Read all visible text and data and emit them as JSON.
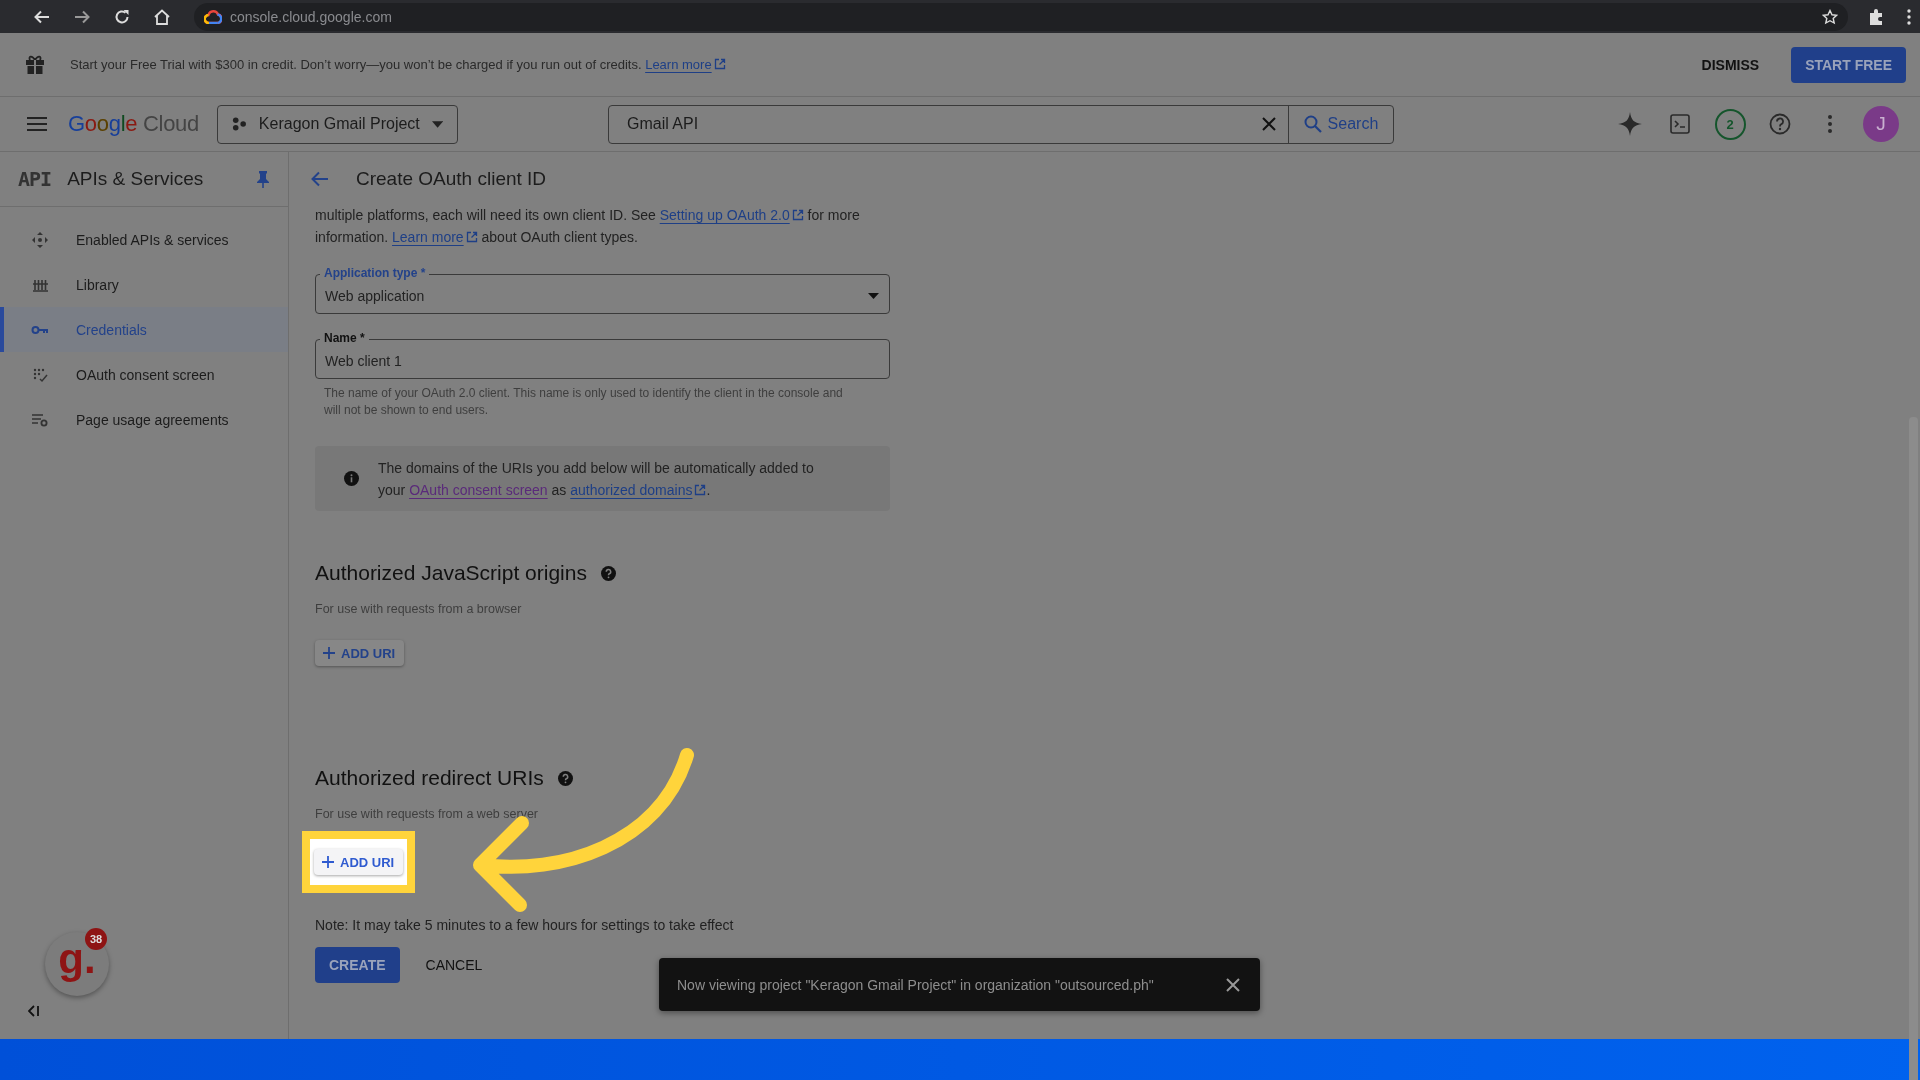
{
  "browser": {
    "url": "console.cloud.google.com"
  },
  "banner": {
    "text": "Start your Free Trial with $300 in credit. Don’t worry—you won’t be charged if you run out of credits.",
    "link": "Learn more",
    "dismiss": "DISMISS",
    "start": "START FREE"
  },
  "header": {
    "logo": "Google",
    "logo_suffix": "Cloud",
    "project": "Keragon Gmail Project",
    "search_value": "Gmail API",
    "search_button": "Search",
    "notifications": "2",
    "avatar": "J"
  },
  "sidebar": {
    "badge": "API",
    "title": "APIs & Services",
    "items": [
      {
        "label": "Enabled APIs & services",
        "selected": false
      },
      {
        "label": "Library",
        "selected": false
      },
      {
        "label": "Credentials",
        "selected": true
      },
      {
        "label": "OAuth consent screen",
        "selected": false
      },
      {
        "label": "Page usage agreements",
        "selected": false
      }
    ]
  },
  "title": "Create OAuth client ID",
  "intro": [
    [
      {
        "text": "multiple platforms, each will need its own client ID. See "
      },
      {
        "text": "Setting up OAuth 2.0",
        "link": true
      },
      {
        "text": " for more"
      }
    ],
    [
      {
        "text": "information. "
      },
      {
        "text": "Learn more",
        "link": true
      },
      {
        "text": " about OAuth client types."
      }
    ]
  ],
  "fields": [
    {
      "kind": "select",
      "label": "Application type *",
      "value": "Web application"
    },
    {
      "kind": "text",
      "label": "Name *",
      "value": "Web client 1",
      "hint": "The name of your OAuth 2.0 client. This name is only used to identify the client in the console and will not be shown to end users."
    }
  ],
  "info": [
    [
      {
        "text": "The domains of the URIs you add below will be automatically added to"
      }
    ],
    [
      {
        "text": "your "
      },
      {
        "text": "OAuth consent screen",
        "link": true,
        "visited": true,
        "external": false
      },
      {
        "text": " as "
      },
      {
        "text": "authorized domains",
        "link": true,
        "visited": false,
        "external": true
      },
      {
        "text": "."
      }
    ]
  ],
  "sections": [
    {
      "title": "Authorized JavaScript origins",
      "subtitle": "For use with requests from a browser",
      "button": "ADD URI",
      "highlighted": false
    },
    {
      "title": "Authorized redirect URIs",
      "subtitle": "For use with requests from a web server",
      "button": "ADD URI",
      "highlighted": true
    }
  ],
  "note": "Note: It may take 5 minutes to a few hours for settings to take effect",
  "actions": [
    {
      "kind": "primary",
      "label": "CREATE"
    },
    {
      "kind": "text",
      "label": "CANCEL"
    }
  ],
  "snackbar": "Now viewing project \"Keragon Gmail Project\" in organization \"outsourced.ph\"",
  "assistant": {
    "label": "g.",
    "badge": "38"
  }
}
